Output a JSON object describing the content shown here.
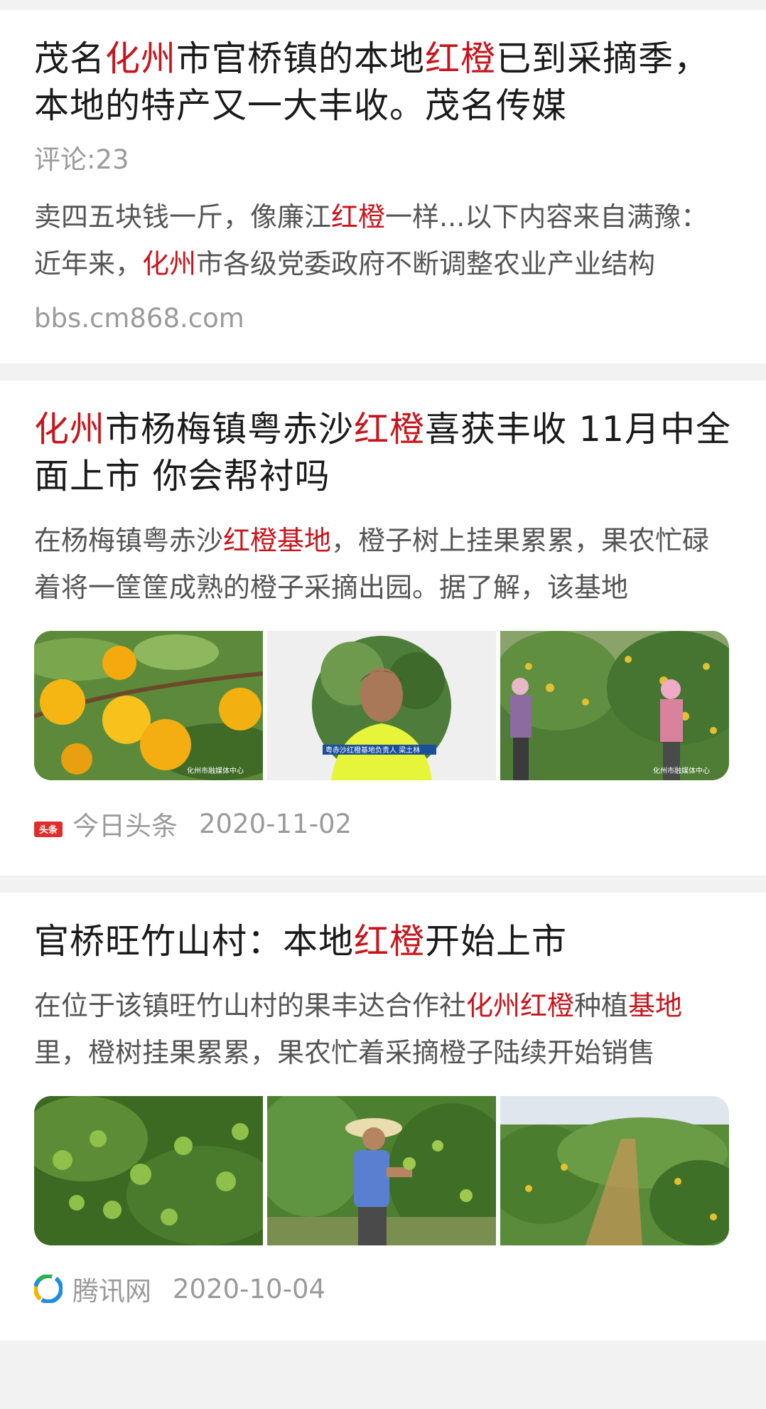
{
  "results": [
    {
      "title_parts": [
        {
          "t": "茂名",
          "h": false
        },
        {
          "t": "化州",
          "h": true
        },
        {
          "t": "市官桥镇的本地",
          "h": false
        },
        {
          "t": "红橙",
          "h": true
        },
        {
          "t": "已到采摘季，本地的特产又一大丰收。茂名传媒",
          "h": false
        }
      ],
      "comments": "评论:23",
      "snippet_parts": [
        {
          "t": "卖四五块钱一斤，像廉江",
          "h": false
        },
        {
          "t": "红橙",
          "h": true
        },
        {
          "t": "一样...以下内容来自满豫：近年来，",
          "h": false
        },
        {
          "t": "化州",
          "h": true
        },
        {
          "t": "市各级党委政府不断调整农业产业结构",
          "h": false
        }
      ],
      "url": "bbs.cm868.com"
    },
    {
      "title_parts": [
        {
          "t": "化州",
          "h": true
        },
        {
          "t": "市杨梅镇粤赤沙",
          "h": false
        },
        {
          "t": "红橙",
          "h": true
        },
        {
          "t": "喜获丰收 11月中全面上市 你会帮衬吗",
          "h": false
        }
      ],
      "snippet_parts": [
        {
          "t": "在杨梅镇粤赤沙",
          "h": false
        },
        {
          "t": "红橙基地",
          "h": true
        },
        {
          "t": "，橙子树上挂果累累，果农忙碌着将一筐筐成熟的橙子采摘出园。据了解，该基地",
          "h": false
        }
      ],
      "source": "今日头条",
      "date": "2020-11-02",
      "source_icon_label": "头条",
      "watermark_1": "化州市融媒体中心",
      "caption_2": "粤赤沙红橙基地负责人 梁土林",
      "watermark_3": "化州市融媒体中心"
    },
    {
      "title_parts": [
        {
          "t": "官桥旺竹山村：本地",
          "h": false
        },
        {
          "t": "红橙",
          "h": true
        },
        {
          "t": "开始上市",
          "h": false
        }
      ],
      "snippet_parts": [
        {
          "t": "在位于该镇旺竹山村的果丰达合作社",
          "h": false
        },
        {
          "t": "化州红橙",
          "h": true
        },
        {
          "t": "种植",
          "h": false
        },
        {
          "t": "基地",
          "h": true
        },
        {
          "t": "里，橙树挂果累累，果农忙着采摘橙子陆续开始销售",
          "h": false
        }
      ],
      "source": "腾讯网",
      "date": "2020-10-04"
    }
  ],
  "colors": {
    "highlight": "#c8151d",
    "meta": "#9a9a9a",
    "title": "#1a1a1a"
  },
  "icons": {
    "toutiao": "toutiao-logo-icon",
    "tencent": "tencent-logo-icon"
  }
}
